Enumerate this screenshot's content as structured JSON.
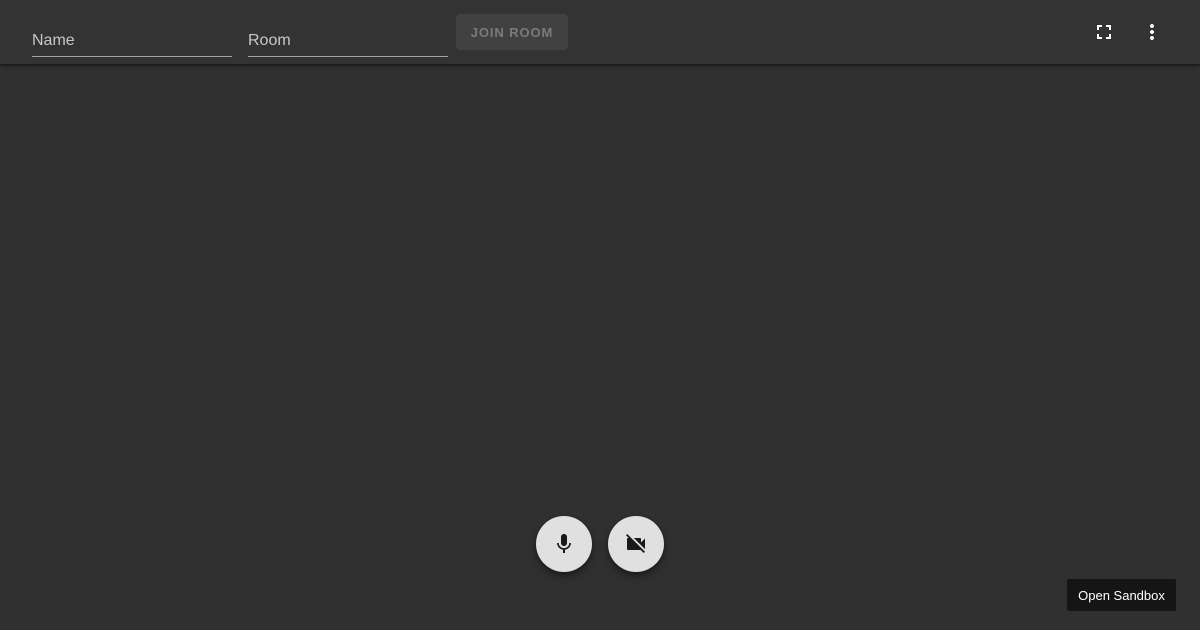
{
  "toolbar": {
    "name_input": {
      "placeholder": "Name",
      "value": ""
    },
    "room_input": {
      "placeholder": "Room",
      "value": ""
    },
    "join_button_label": "Join Room",
    "join_button_state": "disabled",
    "fullscreen_icon": "fullscreen-icon",
    "more_icon": "more-vert-icon"
  },
  "controls": {
    "mic_icon": "mic-icon",
    "camera_icon": "videocam-off-icon"
  },
  "footer": {
    "sandbox_label": "Open Sandbox"
  },
  "colors": {
    "background": "#303030",
    "toolbar": "#333333",
    "fab": "#e0e0e0",
    "sandbox_badge": "#151515"
  }
}
